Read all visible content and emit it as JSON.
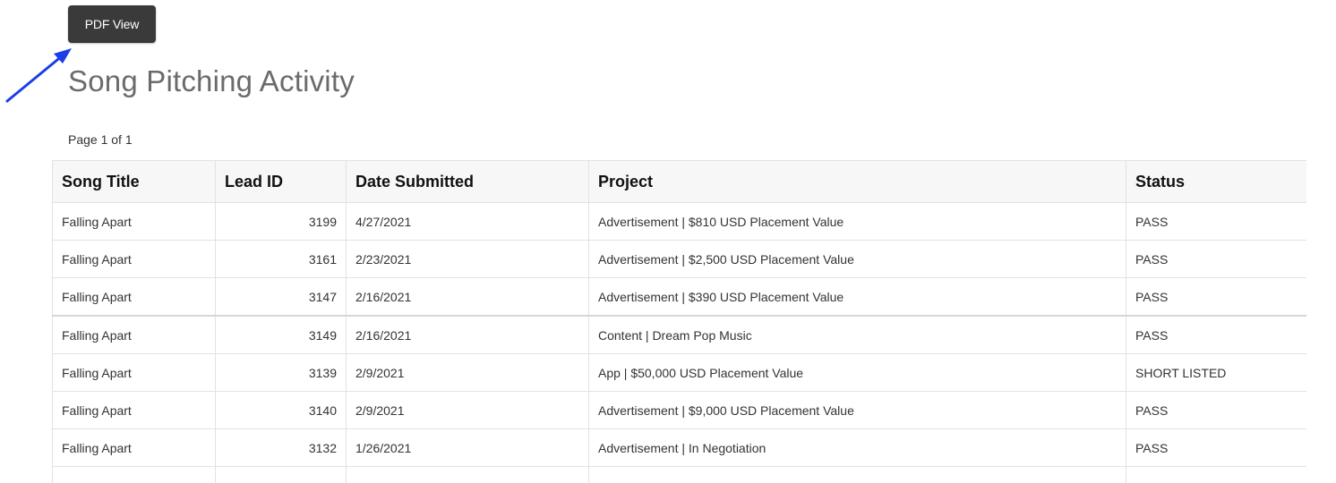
{
  "toolbar": {
    "pdf_view_label": "PDF View"
  },
  "annotation": {
    "arrow_color": "#1a3ee8"
  },
  "page_title": "Song Pitching Activity",
  "pager": {
    "text": "Page 1 of 1"
  },
  "table": {
    "headers": [
      "Song Title",
      "Lead ID",
      "Date Submitted",
      "Project",
      "Status"
    ],
    "rows": [
      [
        "Falling Apart",
        "3199",
        "4/27/2021",
        "Advertisement | $810 USD Placement Value",
        "PASS"
      ],
      [
        "Falling Apart",
        "3161",
        "2/23/2021",
        "Advertisement | $2,500 USD Placement Value",
        "PASS"
      ],
      [
        "Falling Apart",
        "3147",
        "2/16/2021",
        "Advertisement | $390 USD Placement Value",
        "PASS"
      ],
      [
        "Falling Apart",
        "3149",
        "2/16/2021",
        "Content | Dream Pop Music",
        "PASS"
      ],
      [
        "Falling Apart",
        "3139",
        "2/9/2021",
        "App | $50,000 USD Placement Value",
        "SHORT LISTED"
      ],
      [
        "Falling Apart",
        "3140",
        "2/9/2021",
        "Advertisement | $9,000 USD Placement Value",
        "PASS"
      ],
      [
        "Falling Apart",
        "3132",
        "1/26/2021",
        "Advertisement | In Negotiation",
        "PASS"
      ],
      [
        "",
        "",
        "",
        "",
        ""
      ]
    ]
  }
}
